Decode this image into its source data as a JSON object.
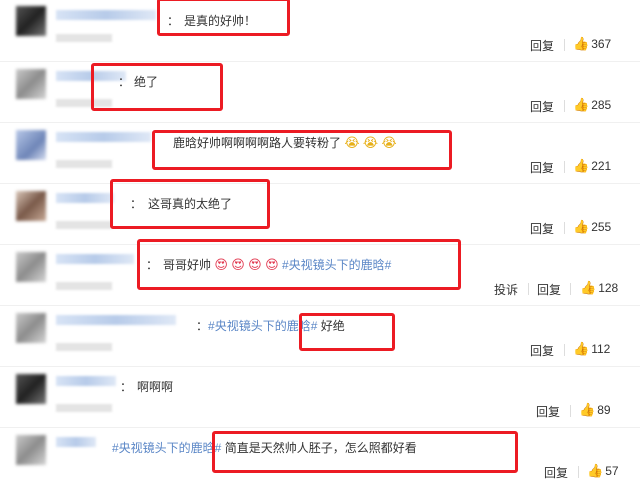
{
  "comments": [
    {
      "text": "是真的好帅！",
      "reply": "回复",
      "likes": "367"
    },
    {
      "text": "绝了",
      "reply": "回复",
      "likes": "285"
    },
    {
      "text": "鹿晗好帅啊啊啊啊路人要转粉了",
      "reply": "回复",
      "likes": "221"
    },
    {
      "text": "这哥真的太绝了",
      "reply": "回复",
      "likes": "255"
    },
    {
      "text": "哥哥好帅",
      "topic": "#央视镜头下的鹿晗#",
      "report": "投诉",
      "reply": "回复",
      "likes": "128"
    },
    {
      "topic": "#央视镜头下的鹿晗#",
      "text": "好绝",
      "reply": "回复",
      "likes": "112"
    },
    {
      "text": "啊啊啊",
      "reply": "回复",
      "likes": "89"
    },
    {
      "topic": "#央视镜头下的鹿晗#",
      "text": "简直是天然帅人胚子，怎么照都好看",
      "reply": "回复",
      "likes": "57"
    }
  ],
  "icons": {
    "like": "thumbs-up-icon",
    "heart_eyes": "heart-eyes-emoji",
    "crying": "crying-emoji"
  },
  "colors": {
    "highlight": "#ec1b23",
    "topic": "#5a86c6"
  }
}
